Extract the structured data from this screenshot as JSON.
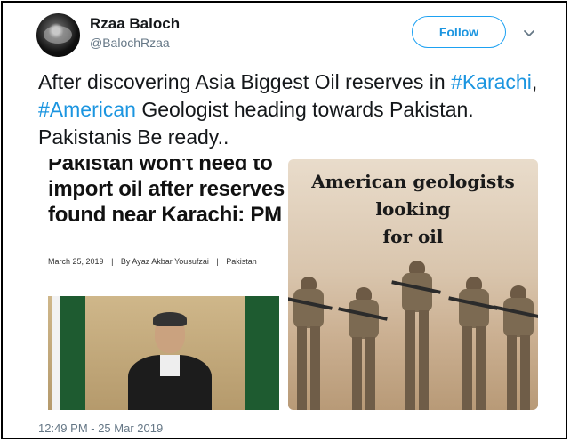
{
  "author": {
    "name": "Rzaa Baloch",
    "handle": "@BalochRzaa",
    "follow_label": "Follow",
    "avatar_icon": "avatar-image"
  },
  "menu_icon": "chevron-down-icon",
  "tweet": {
    "part1": "After discovering Asia Biggest Oil reserves in",
    "tag1": "#Karachi",
    "sep": ", ",
    "tag2": "#American",
    "part2": " Geologist heading towards Pakistan. Pakistanis Be ready..",
    "hashtag_color": "#1b95e0"
  },
  "media": {
    "left": {
      "headline": "Pakistan won't need to import oil after reserves found near Karachi: PM",
      "date": "March 25, 2019",
      "sep": "|",
      "author": "By Ayaz Akbar Yousufzai",
      "category": "Pakistan"
    },
    "right": {
      "line1": "American geologists",
      "line2": "looking",
      "line3": "for oil"
    }
  },
  "timestamp": "12:49 PM - 25 Mar 2019"
}
